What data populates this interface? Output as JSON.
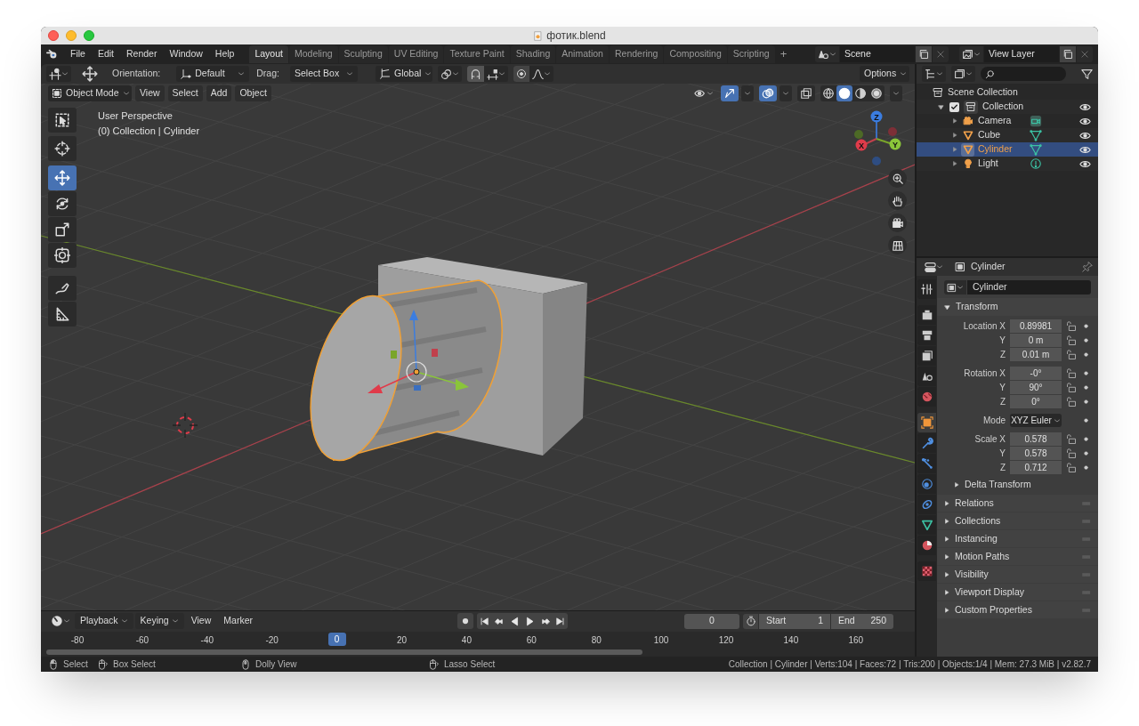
{
  "window": {
    "title": "фотик.blend"
  },
  "menu": [
    "File",
    "Edit",
    "Render",
    "Window",
    "Help"
  ],
  "workspaces": [
    {
      "label": "Layout",
      "selected": true
    },
    {
      "label": "Modeling",
      "selected": false
    },
    {
      "label": "Sculpting",
      "selected": false
    },
    {
      "label": "UV Editing",
      "selected": false
    },
    {
      "label": "Texture Paint",
      "selected": false
    },
    {
      "label": "Shading",
      "selected": false
    },
    {
      "label": "Animation",
      "selected": false
    },
    {
      "label": "Rendering",
      "selected": false
    },
    {
      "label": "Compositing",
      "selected": false
    },
    {
      "label": "Scripting",
      "selected": false
    }
  ],
  "add_workspace": "+",
  "scene": "Scene",
  "view_layer": "View Layer",
  "tool_header": {
    "orientation_label": "Orientation:",
    "orientation": "Default",
    "drag_label": "Drag:",
    "drag": "Select Box",
    "transform": "Global",
    "options": "Options"
  },
  "viewport_header": {
    "mode": "Object Mode",
    "menus": [
      "View",
      "Select",
      "Add",
      "Object"
    ],
    "toggles": [
      {
        "kind": "gizmo",
        "on": true
      },
      {
        "kind": "overlay",
        "on": true
      },
      {
        "kind": "xray",
        "on": false
      }
    ],
    "shading": [
      {
        "kind": "wireframe",
        "selected": false
      },
      {
        "kind": "solid",
        "selected": true
      },
      {
        "kind": "material",
        "selected": false
      },
      {
        "kind": "rendered",
        "selected": false
      }
    ]
  },
  "viewport": {
    "perspective": "User Perspective",
    "context": "(0) Collection | Cylinder",
    "axes": [
      "X",
      "Y",
      "Z"
    ]
  },
  "toolbar": [
    {
      "kind": "select",
      "selected": false
    },
    {
      "kind": "cursor",
      "selected": false
    },
    {
      "kind": "move",
      "selected": true
    },
    {
      "kind": "rotate",
      "selected": false
    },
    {
      "kind": "scale",
      "selected": false
    },
    {
      "kind": "transform",
      "selected": false
    },
    {
      "kind": "annotate",
      "selected": false
    },
    {
      "kind": "measure",
      "selected": false
    }
  ],
  "outliner": {
    "root": "Scene Collection",
    "collections": [
      {
        "name": "Collection",
        "checked": true,
        "expanded": true,
        "children": [
          {
            "name": "Camera",
            "kind": "camera",
            "selected": false
          },
          {
            "name": "Cube",
            "kind": "mesh",
            "selected": false
          },
          {
            "name": "Cylinder",
            "kind": "mesh",
            "selected": true
          },
          {
            "name": "Light",
            "kind": "light",
            "selected": false
          }
        ]
      }
    ]
  },
  "properties": {
    "tabs": [
      {
        "kind": "tool",
        "selected": false
      },
      {
        "kind": "render",
        "selected": false
      },
      {
        "kind": "output",
        "selected": false
      },
      {
        "kind": "view_layer",
        "selected": false
      },
      {
        "kind": "scene",
        "selected": false
      },
      {
        "kind": "world",
        "selected": false
      },
      {
        "kind": "object",
        "selected": true
      },
      {
        "kind": "modifiers",
        "selected": false
      },
      {
        "kind": "particles",
        "selected": false
      },
      {
        "kind": "physics",
        "selected": false
      },
      {
        "kind": "constraints",
        "selected": false
      },
      {
        "kind": "data",
        "selected": false
      },
      {
        "kind": "material",
        "selected": false
      },
      {
        "kind": "texture",
        "selected": false
      }
    ],
    "object_name": "Cylinder",
    "name_field": "Cylinder",
    "transform": {
      "title": "Transform",
      "expanded": true,
      "groups": [
        {
          "rows": [
            {
              "kind": "number",
              "label": "Location X",
              "value": "0.89981"
            },
            {
              "kind": "number",
              "label": "Y",
              "value": "0 m"
            },
            {
              "kind": "number",
              "label": "Z",
              "value": "0.01 m"
            }
          ]
        },
        {
          "rows": [
            {
              "kind": "number",
              "label": "Rotation X",
              "value": "-0°"
            },
            {
              "kind": "number",
              "label": "Y",
              "value": "90°"
            },
            {
              "kind": "number",
              "label": "Z",
              "value": "0°"
            }
          ]
        },
        {
          "rows": [
            {
              "kind": "dropdown",
              "label": "Mode",
              "value": "XYZ Euler"
            }
          ]
        },
        {
          "rows": [
            {
              "kind": "number",
              "label": "Scale X",
              "value": "0.578"
            },
            {
              "kind": "number",
              "label": "Y",
              "value": "0.578"
            },
            {
              "kind": "number",
              "label": "Z",
              "value": "0.712"
            }
          ]
        }
      ],
      "subpanel": {
        "title": "Delta Transform",
        "expanded": false
      }
    },
    "panels": [
      {
        "title": "Relations",
        "expanded": false
      },
      {
        "title": "Collections",
        "expanded": false
      },
      {
        "title": "Instancing",
        "expanded": false
      },
      {
        "title": "Motion Paths",
        "expanded": false
      },
      {
        "title": "Visibility",
        "expanded": false
      },
      {
        "title": "Viewport Display",
        "expanded": false
      },
      {
        "title": "Custom Properties",
        "expanded": false
      }
    ]
  },
  "timeline": {
    "menus": [
      "Playback",
      "Keying",
      "View",
      "Marker"
    ],
    "current_frame": "0",
    "start_label": "Start",
    "start": "1",
    "end_label": "End",
    "end": "250",
    "ticks": [
      {
        "label": "-80",
        "current": false
      },
      {
        "label": "-60",
        "current": false
      },
      {
        "label": "-40",
        "current": false
      },
      {
        "label": "-20",
        "current": false
      },
      {
        "label": "0",
        "current": true
      },
      {
        "label": "20",
        "current": false
      },
      {
        "label": "40",
        "current": false
      },
      {
        "label": "60",
        "current": false
      },
      {
        "label": "80",
        "current": false
      },
      {
        "label": "100",
        "current": false
      },
      {
        "label": "120",
        "current": false
      },
      {
        "label": "140",
        "current": false
      },
      {
        "label": "160",
        "current": false
      }
    ]
  },
  "status_bar": {
    "hints": [
      {
        "kind": "left",
        "label": "Select"
      },
      {
        "kind": "drag",
        "label": "Box Select"
      },
      {
        "kind": "middle",
        "label": "Dolly View"
      },
      {
        "kind": "right",
        "label": "Lasso Select"
      }
    ],
    "stats": "Collection | Cylinder | Verts:104 | Faces:72 | Tris:200 | Objects:1/4 | Mem: 27.3 MiB | v2.82.7"
  }
}
